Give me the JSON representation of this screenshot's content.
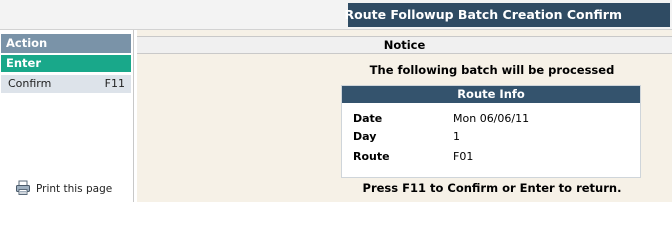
{
  "header": {
    "title": "Route Followup Batch Creation Confirm"
  },
  "sidebar": {
    "heading": "Action",
    "items": [
      {
        "label": "Enter",
        "key": ""
      },
      {
        "label": "Confirm",
        "key": "F11"
      }
    ],
    "print_label": "Print this page",
    "print_icon": "printer-icon"
  },
  "main": {
    "notice_title": "Notice",
    "lead": "The following batch will be processed",
    "info": {
      "title": "Route Info",
      "rows": [
        {
          "label": "Date",
          "value": "Mon 06/06/11"
        },
        {
          "label": "Day",
          "value": "1"
        },
        {
          "label": "Route",
          "value": "F01"
        }
      ]
    },
    "footer": "Press F11 to Confirm or Enter to return."
  },
  "colors": {
    "header_bar": "#2f4b63",
    "action_head": "#7a93a8",
    "enter_highlight": "#19a88a",
    "confirm_row": "#dde3ea",
    "content_bg": "#f6f1e7",
    "info_head": "#34536d"
  }
}
